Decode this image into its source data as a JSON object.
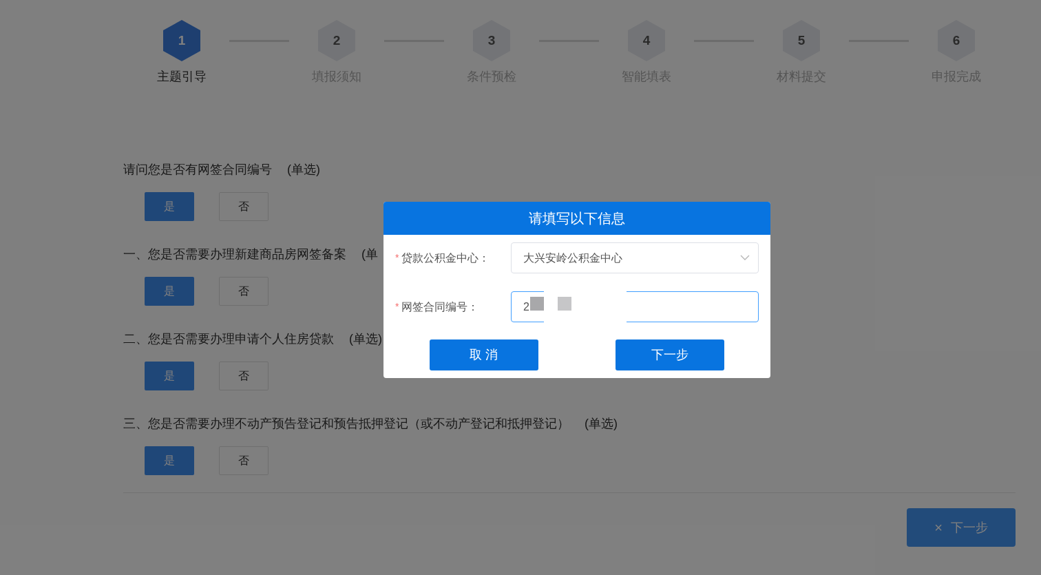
{
  "steps": [
    {
      "number": "1",
      "label": "主题引导",
      "selected": true
    },
    {
      "number": "2",
      "label": "填报须知",
      "selected": false
    },
    {
      "number": "3",
      "label": "条件预检",
      "selected": false
    },
    {
      "number": "4",
      "label": "智能填表",
      "selected": false
    },
    {
      "number": "5",
      "label": "材料提交",
      "selected": false
    },
    {
      "number": "6",
      "label": "申报完成",
      "selected": false
    }
  ],
  "questions": [
    {
      "text": "请问您是否有网签合同编号",
      "tag": "(单选)",
      "options": [
        {
          "label": "是",
          "selected": true
        },
        {
          "label": "否",
          "selected": false
        }
      ]
    },
    {
      "text": "一、您是否需要办理新建商品房网签备案",
      "tag": "(单",
      "options": [
        {
          "label": "是",
          "selected": true
        },
        {
          "label": "否",
          "selected": false
        }
      ]
    },
    {
      "text": "二、您是否需要办理申请个人住房贷款",
      "tag": "(单选)",
      "options": [
        {
          "label": "是",
          "selected": true
        },
        {
          "label": "否",
          "selected": false
        }
      ]
    },
    {
      "text": "三、您是否需要办理不动产预告登记和预告抵押登记（或不动产登记和抵押登记）",
      "tag": "(单选)",
      "options": [
        {
          "label": "是",
          "selected": true
        },
        {
          "label": "否",
          "selected": false
        }
      ]
    }
  ],
  "next_button": {
    "icon": "×",
    "label": "下一步"
  },
  "dialog": {
    "title": "请填写以下信息",
    "fields": [
      {
        "kind": "select",
        "label": "贷款公积金中心：",
        "required_mark": "*",
        "value": "大兴安岭公积金中心",
        "focused": false
      },
      {
        "kind": "input",
        "label": "网签合同编号：",
        "required_mark": "*",
        "value": "2",
        "focused": true
      }
    ],
    "buttons": [
      "取 消",
      "下一步"
    ]
  }
}
